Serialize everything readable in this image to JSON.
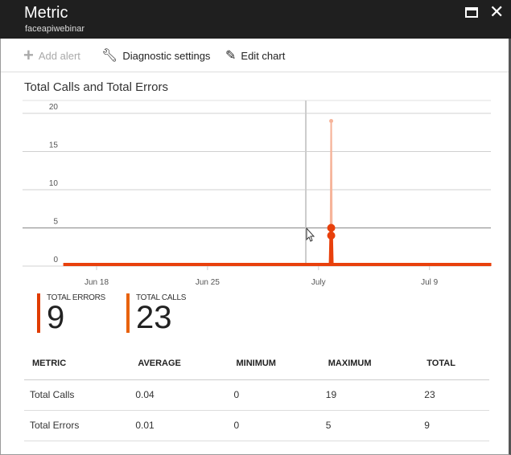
{
  "window": {
    "title": "Metric",
    "subtitle": "faceapiwebinar"
  },
  "toolbar": {
    "add_alert": "Add alert",
    "diagnostic": "Diagnostic settings",
    "edit_chart": "Edit chart"
  },
  "chart_data": {
    "type": "line",
    "title": "Total Calls and Total Errors",
    "ylim": [
      0,
      20
    ],
    "yticks": [
      "0",
      "5",
      "10",
      "15",
      "20"
    ],
    "xticks": [
      {
        "label": "Jun 18",
        "day": 0
      },
      {
        "label": "Jun 25",
        "day": 7
      },
      {
        "label": "July",
        "day": 14
      },
      {
        "label": "Jul 9",
        "day": 21
      }
    ],
    "xrange_days": [
      -2.1,
      24.9
    ],
    "series": [
      {
        "name": "Total Calls",
        "color": "#f6b49a",
        "points": [
          {
            "day": 14.8,
            "value": 19
          },
          {
            "day": 14.8,
            "value": 4
          }
        ]
      },
      {
        "name": "Total Errors",
        "color": "#e8400c",
        "points": [
          {
            "day": 14.8,
            "value": 5
          },
          {
            "day": 14.8,
            "value": 4
          }
        ]
      }
    ],
    "cursor_day": 13.2
  },
  "stats": [
    {
      "label": "TOTAL ERRORS",
      "value": "9",
      "color": "#e03c00"
    },
    {
      "label": "TOTAL CALLS",
      "value": "23",
      "color": "#e8620e"
    }
  ],
  "table": {
    "headers": [
      "METRIC",
      "AVERAGE",
      "MINIMUM",
      "MAXIMUM",
      "TOTAL"
    ],
    "rows": [
      [
        "Total Calls",
        "0.04",
        "0",
        "19",
        "23"
      ],
      [
        "Total Errors",
        "0.01",
        "0",
        "5",
        "9"
      ]
    ]
  }
}
